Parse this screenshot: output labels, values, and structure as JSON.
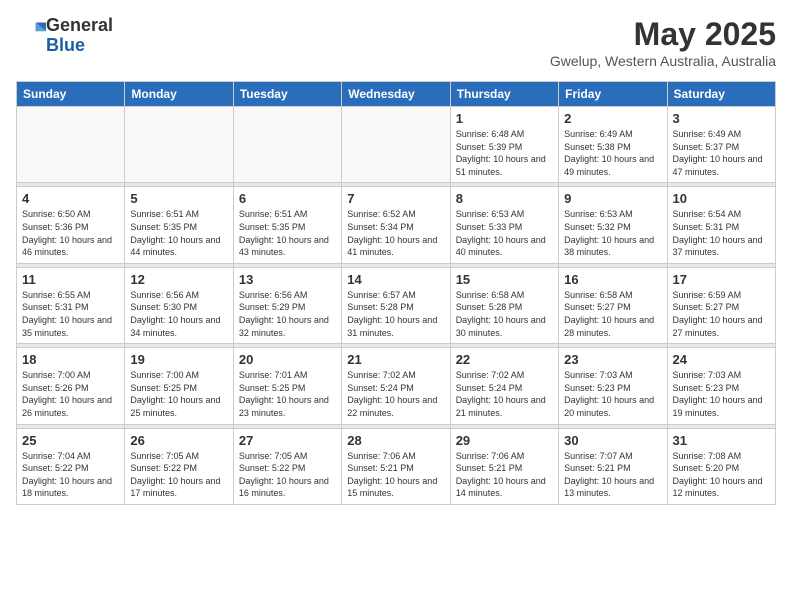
{
  "header": {
    "logo_general": "General",
    "logo_blue": "Blue",
    "month_title": "May 2025",
    "location": "Gwelup, Western Australia, Australia"
  },
  "weekdays": [
    "Sunday",
    "Monday",
    "Tuesday",
    "Wednesday",
    "Thursday",
    "Friday",
    "Saturday"
  ],
  "weeks": [
    [
      {
        "day": "",
        "empty": true
      },
      {
        "day": "",
        "empty": true
      },
      {
        "day": "",
        "empty": true
      },
      {
        "day": "",
        "empty": true
      },
      {
        "day": "1",
        "sunrise": "6:48 AM",
        "sunset": "5:39 PM",
        "daylight": "10 hours and 51 minutes."
      },
      {
        "day": "2",
        "sunrise": "6:49 AM",
        "sunset": "5:38 PM",
        "daylight": "10 hours and 49 minutes."
      },
      {
        "day": "3",
        "sunrise": "6:49 AM",
        "sunset": "5:37 PM",
        "daylight": "10 hours and 47 minutes."
      }
    ],
    [
      {
        "day": "4",
        "sunrise": "6:50 AM",
        "sunset": "5:36 PM",
        "daylight": "10 hours and 46 minutes."
      },
      {
        "day": "5",
        "sunrise": "6:51 AM",
        "sunset": "5:35 PM",
        "daylight": "10 hours and 44 minutes."
      },
      {
        "day": "6",
        "sunrise": "6:51 AM",
        "sunset": "5:35 PM",
        "daylight": "10 hours and 43 minutes."
      },
      {
        "day": "7",
        "sunrise": "6:52 AM",
        "sunset": "5:34 PM",
        "daylight": "10 hours and 41 minutes."
      },
      {
        "day": "8",
        "sunrise": "6:53 AM",
        "sunset": "5:33 PM",
        "daylight": "10 hours and 40 minutes."
      },
      {
        "day": "9",
        "sunrise": "6:53 AM",
        "sunset": "5:32 PM",
        "daylight": "10 hours and 38 minutes."
      },
      {
        "day": "10",
        "sunrise": "6:54 AM",
        "sunset": "5:31 PM",
        "daylight": "10 hours and 37 minutes."
      }
    ],
    [
      {
        "day": "11",
        "sunrise": "6:55 AM",
        "sunset": "5:31 PM",
        "daylight": "10 hours and 35 minutes."
      },
      {
        "day": "12",
        "sunrise": "6:56 AM",
        "sunset": "5:30 PM",
        "daylight": "10 hours and 34 minutes."
      },
      {
        "day": "13",
        "sunrise": "6:56 AM",
        "sunset": "5:29 PM",
        "daylight": "10 hours and 32 minutes."
      },
      {
        "day": "14",
        "sunrise": "6:57 AM",
        "sunset": "5:28 PM",
        "daylight": "10 hours and 31 minutes."
      },
      {
        "day": "15",
        "sunrise": "6:58 AM",
        "sunset": "5:28 PM",
        "daylight": "10 hours and 30 minutes."
      },
      {
        "day": "16",
        "sunrise": "6:58 AM",
        "sunset": "5:27 PM",
        "daylight": "10 hours and 28 minutes."
      },
      {
        "day": "17",
        "sunrise": "6:59 AM",
        "sunset": "5:27 PM",
        "daylight": "10 hours and 27 minutes."
      }
    ],
    [
      {
        "day": "18",
        "sunrise": "7:00 AM",
        "sunset": "5:26 PM",
        "daylight": "10 hours and 26 minutes."
      },
      {
        "day": "19",
        "sunrise": "7:00 AM",
        "sunset": "5:25 PM",
        "daylight": "10 hours and 25 minutes."
      },
      {
        "day": "20",
        "sunrise": "7:01 AM",
        "sunset": "5:25 PM",
        "daylight": "10 hours and 23 minutes."
      },
      {
        "day": "21",
        "sunrise": "7:02 AM",
        "sunset": "5:24 PM",
        "daylight": "10 hours and 22 minutes."
      },
      {
        "day": "22",
        "sunrise": "7:02 AM",
        "sunset": "5:24 PM",
        "daylight": "10 hours and 21 minutes."
      },
      {
        "day": "23",
        "sunrise": "7:03 AM",
        "sunset": "5:23 PM",
        "daylight": "10 hours and 20 minutes."
      },
      {
        "day": "24",
        "sunrise": "7:03 AM",
        "sunset": "5:23 PM",
        "daylight": "10 hours and 19 minutes."
      }
    ],
    [
      {
        "day": "25",
        "sunrise": "7:04 AM",
        "sunset": "5:22 PM",
        "daylight": "10 hours and 18 minutes."
      },
      {
        "day": "26",
        "sunrise": "7:05 AM",
        "sunset": "5:22 PM",
        "daylight": "10 hours and 17 minutes."
      },
      {
        "day": "27",
        "sunrise": "7:05 AM",
        "sunset": "5:22 PM",
        "daylight": "10 hours and 16 minutes."
      },
      {
        "day": "28",
        "sunrise": "7:06 AM",
        "sunset": "5:21 PM",
        "daylight": "10 hours and 15 minutes."
      },
      {
        "day": "29",
        "sunrise": "7:06 AM",
        "sunset": "5:21 PM",
        "daylight": "10 hours and 14 minutes."
      },
      {
        "day": "30",
        "sunrise": "7:07 AM",
        "sunset": "5:21 PM",
        "daylight": "10 hours and 13 minutes."
      },
      {
        "day": "31",
        "sunrise": "7:08 AM",
        "sunset": "5:20 PM",
        "daylight": "10 hours and 12 minutes."
      }
    ]
  ]
}
